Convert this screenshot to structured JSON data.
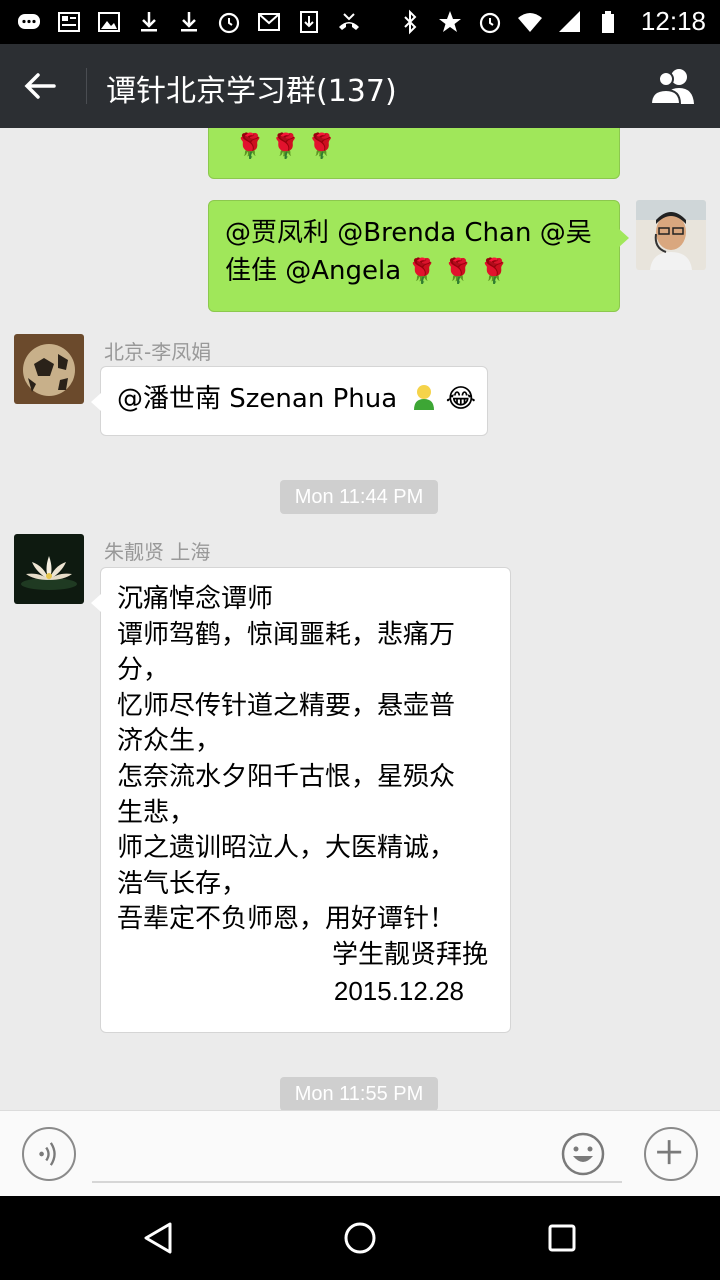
{
  "status_bar": {
    "time": "12:18",
    "left_icons": [
      "message-icon",
      "news-icon",
      "gallery-icon",
      "download-icon",
      "download-icon",
      "alarm-icon",
      "gmail-icon",
      "download-box-icon",
      "missed-call-icon"
    ],
    "right_icons": [
      "bluetooth-icon",
      "star-icon",
      "alarm-icon",
      "wifi-icon",
      "signal-icon",
      "battery-icon"
    ]
  },
  "header": {
    "title": "谭针北京学习群(137)"
  },
  "messages": {
    "m1": {
      "roses": "🌹🌹🌹"
    },
    "m2": {
      "line1": "@贾凤利 @Brenda Chan @吴",
      "line2": "佳佳 @Angela",
      "roses": "🌹🌹🌹"
    },
    "m3": {
      "sender": "北京-李凤娟",
      "text": "@潘世南 Szenan Phua",
      "emoji": "😂"
    },
    "time1": "Mon 11:44 PM",
    "m4": {
      "sender": "朱靓贤 上海",
      "lines": [
        "沉痛悼念谭师",
        "谭师驾鹤，惊闻噩耗，悲痛万",
        "分，",
        "忆师尽传针道之精要，悬壶普",
        "济众生，",
        "怎奈流水夕阳千古恨，星殒众",
        "生悲，",
        "师之遗训昭泣人，大医精诚，",
        "浩气长存，",
        "吾辈定不负师恩，用好谭针！"
      ],
      "sign": "学生靓贤拜挽",
      "date": "2015.12.28"
    },
    "time2": "Mon 11:55 PM"
  },
  "input": {
    "placeholder": ""
  },
  "colors": {
    "bubble_green": "#a0e75a",
    "title_bar": "#2c2f33",
    "chat_bg": "#ebebeb"
  }
}
